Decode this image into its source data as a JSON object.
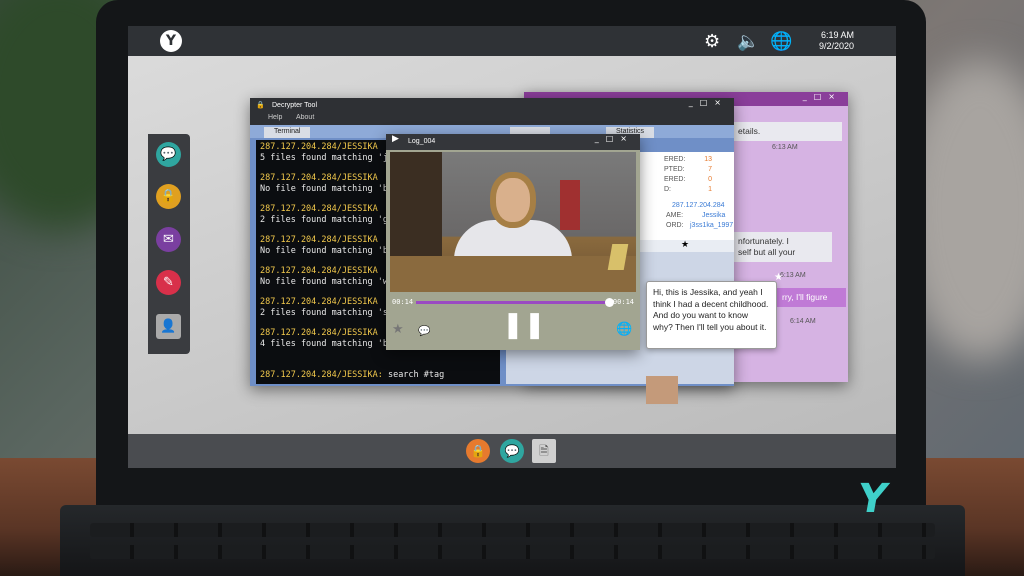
{
  "clock": {
    "time": "6:19 AM",
    "date": "9/2/2020"
  },
  "decrypter": {
    "title": "Decrypter Tool",
    "menu": [
      "Help",
      "About"
    ],
    "tabs": [
      "Terminal",
      "",
      "Statistics"
    ],
    "terminal_lines": [
      {
        "ip": "287.127.204.284/JESSIKA",
        "msg": "5 files found matching 'j"
      },
      {
        "ip": "287.127.204.284/JESSIKA",
        "msg": "No file found matching 'b"
      },
      {
        "ip": "287.127.204.284/JESSIKA",
        "msg": "2 files found matching 'g"
      },
      {
        "ip": "287.127.204.284/JESSIKA",
        "msg": "No file found matching 'b"
      },
      {
        "ip": "287.127.204.284/JESSIKA",
        "msg": "No file found matching 'w"
      },
      {
        "ip": "287.127.204.284/JESSIKA",
        "msg": "2 files found matching 's"
      },
      {
        "ip": "287.127.204.284/JESSIKA",
        "msg": "4 files found matching 'b"
      }
    ],
    "prompt_ip": "287.127.204.284/JESSIKA:",
    "prompt_cmd": "search #tag"
  },
  "stats": {
    "rows": [
      {
        "label": "ERED:",
        "value": "13"
      },
      {
        "label": "PTED:",
        "value": "7"
      },
      {
        "label": "ERED:",
        "value": "0"
      },
      {
        "label": "D:",
        "value": "1"
      }
    ],
    "ip": "287.127.204.284",
    "name_label": "AME:",
    "name_value": "Jessika",
    "pw_label": "ORD:",
    "pw_value": "j3ss1ka_1997"
  },
  "chat": {
    "bubble1": "etails.",
    "time1": "6:13 AM",
    "bubble2": "nfortunately. I\nself but all your",
    "time2": "6:13 AM",
    "bubble3": "rry, I'll figure",
    "time3": "6:14 AM"
  },
  "video": {
    "title": "Log_004",
    "time_current": "00:14",
    "time_total": "00:14",
    "progress": 1.0
  },
  "tooltip": {
    "text": "Hi, this is Jessika, and yeah I think I had a decent childhood. And do you want to know why? Then I'll tell you about it."
  }
}
